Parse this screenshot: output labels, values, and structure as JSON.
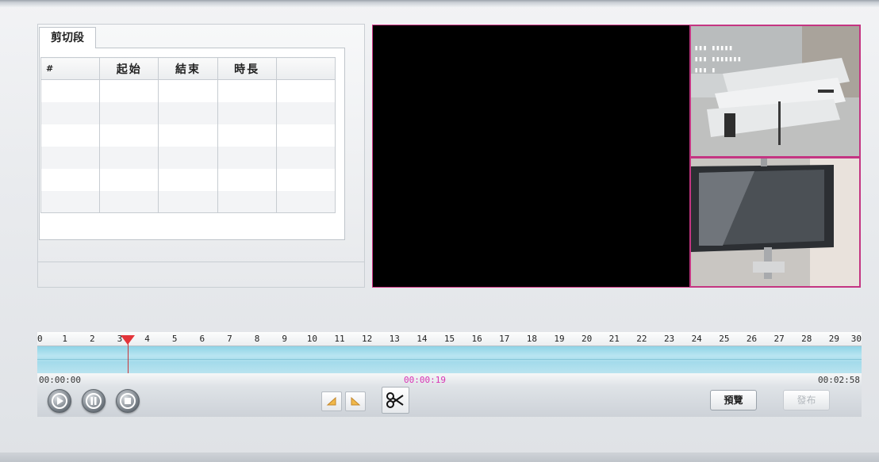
{
  "clips": {
    "tab_label": "剪切段",
    "columns": [
      "#",
      "起始",
      "結束",
      "時長",
      ""
    ],
    "rows": [
      [
        "",
        "",
        "",
        "",
        ""
      ],
      [
        "",
        "",
        "",
        "",
        ""
      ],
      [
        "",
        "",
        "",
        "",
        ""
      ],
      [
        "",
        "",
        "",
        "",
        ""
      ],
      [
        "",
        "",
        "",
        "",
        ""
      ],
      [
        "",
        "",
        "",
        "",
        ""
      ]
    ]
  },
  "timeline": {
    "ticks": [
      "0",
      "1",
      "2",
      "3",
      "4",
      "5",
      "6",
      "7",
      "8",
      "9",
      "10",
      "11",
      "12",
      "13",
      "14",
      "15",
      "16",
      "17",
      "18",
      "19",
      "20",
      "21",
      "22",
      "23",
      "24",
      "25",
      "26",
      "27",
      "28",
      "29",
      "30"
    ],
    "start_time": "00:00:00",
    "current_time": "00:00:19",
    "end_time": "00:02:58",
    "cursor_position": 3.3
  },
  "buttons": {
    "preview_label": "預覽",
    "publish_label": "發布"
  },
  "colors": {
    "cursor": "#e3343a",
    "current_time": "#d933b4",
    "video_border": "#c43582",
    "track": "#a4dbeb"
  }
}
